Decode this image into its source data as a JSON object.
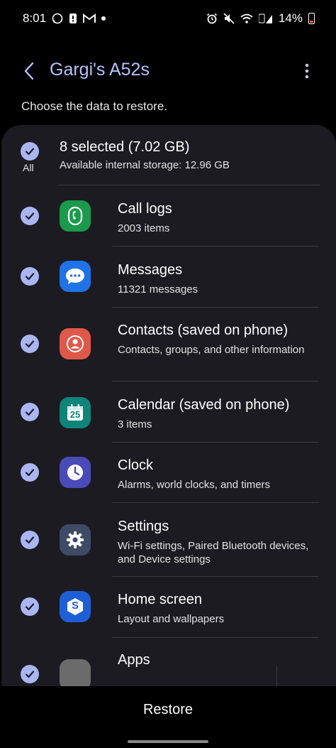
{
  "status_bar": {
    "time": "8:01",
    "battery_percent": "14%"
  },
  "header": {
    "title": "Gargi's A52s"
  },
  "subtitle": "Choose the data to restore.",
  "select_all": {
    "label": "All",
    "title": "8 selected (7.02 GB)",
    "subtitle": "Available internal storage: 12.96 GB"
  },
  "items": [
    {
      "title": "Call logs",
      "subtitle": "2003 items",
      "icon": "phone-icon",
      "color": "#1a9a4c"
    },
    {
      "title": "Messages",
      "subtitle": "11321 messages",
      "icon": "chat-bubble-icon",
      "color": "#1f73e6"
    },
    {
      "title": "Contacts (saved on phone)",
      "subtitle": "Contacts, groups, and other information",
      "icon": "person-icon",
      "color": "#e0584a"
    },
    {
      "title": "Calendar (saved on phone)",
      "subtitle": "3 items",
      "icon": "calendar-icon",
      "color": "#0e8578",
      "badge": "25"
    },
    {
      "title": "Clock",
      "subtitle": "Alarms, world clocks, and timers",
      "icon": "clock-icon",
      "color": "#4a4ab8"
    },
    {
      "title": "Settings",
      "subtitle": "Wi-Fi settings, Paired Bluetooth devices, and Device settings",
      "icon": "gear-icon",
      "color": "#3e4a66"
    },
    {
      "title": "Home screen",
      "subtitle": "Layout and wallpapers",
      "icon": "home-screen-icon",
      "color": "#1f5fd6",
      "badge": "S"
    },
    {
      "title": "Apps",
      "subtitle": "",
      "icon": "apps-icon",
      "color": "#6b6b6b"
    }
  ],
  "footer": {
    "restore_label": "Restore"
  },
  "colors": {
    "accent": "#b8c2ff",
    "check": "#a9b6f2",
    "card": "#1c1b21"
  }
}
